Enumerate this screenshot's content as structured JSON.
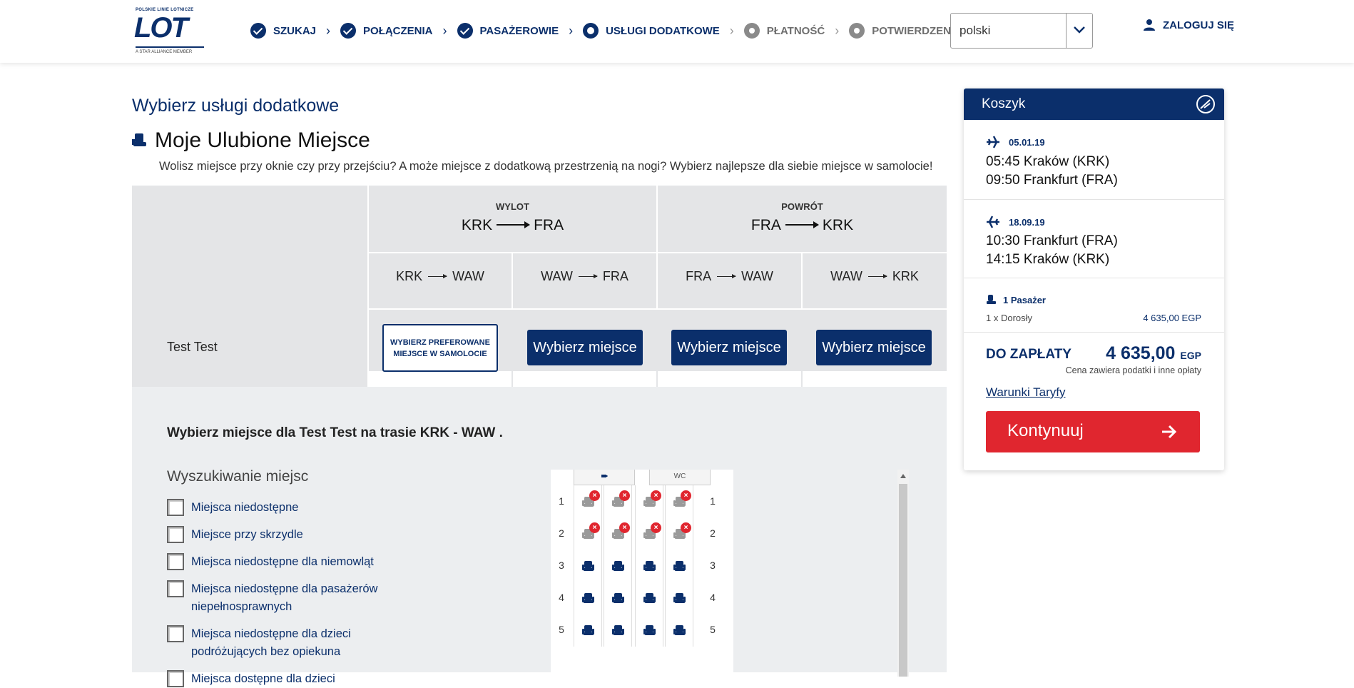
{
  "header": {
    "logo": {
      "top": "POLSKIE LINIE LOTNICZE",
      "mark": "LOT",
      "bottom": "A STAR ALLIANCE MEMBER"
    },
    "steps": [
      {
        "label": "SZUKAJ",
        "state": "done"
      },
      {
        "label": "POŁĄCZENIA",
        "state": "done"
      },
      {
        "label": "PASAŻEROWIE",
        "state": "done"
      },
      {
        "label": "USŁUGI DODATKOWE",
        "state": "current"
      },
      {
        "label": "PŁATNOŚĆ",
        "state": "todo"
      },
      {
        "label": "POTWIERDZENIE",
        "state": "todo"
      }
    ],
    "language": "polski",
    "login": "ZALOGUJ SIĘ"
  },
  "main": {
    "page_title": "Wybierz usługi dodatkowe",
    "section_title": "Moje Ulubione Miejsce",
    "section_desc": "Wolisz miejsce przy oknie czy przy przejściu? A może miejsce z dodatkową przestrzenią na nogi? Wybierz najlepsze dla siebie miejsce w samolocie!",
    "directions": [
      {
        "label": "WYLOT",
        "from": "KRK",
        "to": "FRA"
      },
      {
        "label": "POWRÓT",
        "from": "FRA",
        "to": "KRK"
      }
    ],
    "segments": [
      {
        "from": "KRK",
        "to": "WAW"
      },
      {
        "from": "WAW",
        "to": "FRA"
      },
      {
        "from": "FRA",
        "to": "WAW"
      },
      {
        "from": "WAW",
        "to": "KRK"
      }
    ],
    "passenger": "Test Test",
    "preferred_btn": "WYBIERZ PREFEROWANE MIEJSCE W SAMOLOCIE",
    "choose_seat_btn": "Wybierz miejsce",
    "seat_heading": "Wybierz miejsce dla Test Test na trasie KRK - WAW .",
    "filter_title": "Wyszukiwanie miejsc",
    "filters": [
      "Miejsca niedostępne",
      "Miejsce przy skrzydle",
      "Miejsca niedostępne dla niemowląt",
      "Miejsca niedostępne dla pasażerów niepełnosprawnych",
      "Miejsca niedostępne dla dzieci podróżujących bez opiekuna",
      "Miejsca dostępne dla dzieci"
    ],
    "seatmap": {
      "facilities": [
        "galley-icon",
        "WC"
      ],
      "rows": [
        "1",
        "2",
        "3",
        "4",
        "5"
      ],
      "unavailable_rows": [
        "1",
        "2"
      ]
    }
  },
  "cart": {
    "title": "Koszyk",
    "flights": [
      {
        "date": "05.01.19",
        "dep": "05:45 Kraków (KRK)",
        "arr": "09:50 Frankfurt (FRA)"
      },
      {
        "date": "18.09.19",
        "dep": "10:30 Frankfurt (FRA)",
        "arr": "14:15 Kraków (KRK)"
      }
    ],
    "pax_header": "1 Pasażer",
    "pax_line": "1 x Dorosły",
    "pax_price": "4 635,00 EGP",
    "total_label": "DO ZAPŁATY",
    "total_amount": "4 635,00",
    "total_currency": "EGP",
    "total_note": "Cena zawiera podatki i inne opłaty",
    "fare_link": "Warunki Taryfy",
    "continue_btn": "Kontynuuj"
  },
  "colors": {
    "navy": "#0b2f6b",
    "red": "#e0262f",
    "grey_bg": "#e4e5e7"
  }
}
